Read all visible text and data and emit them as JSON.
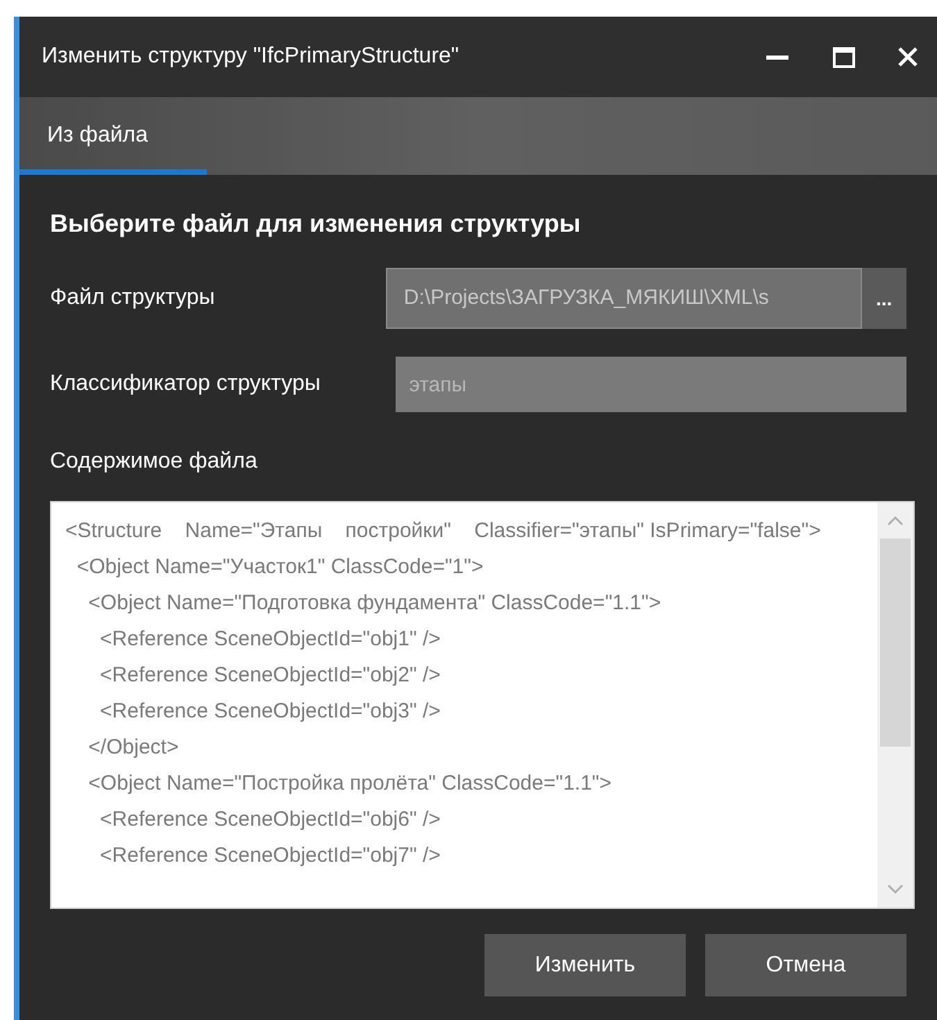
{
  "window": {
    "title": "Изменить структуру \"IfcPrimaryStructure\""
  },
  "tabs": [
    {
      "label": "Из файла",
      "selected": true
    }
  ],
  "heading": "Выберите файл для изменения структуры",
  "file_field": {
    "label": "Файл структуры",
    "value": "D:\\Projects\\ЗАГРУЗКА_МЯКИШ\\XML\\s",
    "browse": "..."
  },
  "classifier_field": {
    "label": "Классификатор структуры",
    "placeholder": "этапы"
  },
  "content": {
    "label": "Содержимое файла",
    "lines": [
      "<Structure    Name=\"Этапы    постройки\"    Classifier=\"этапы\" IsPrimary=\"false\">",
      "  <Object Name=\"Участок1\" ClassCode=\"1\">",
      "    <Object Name=\"Подготовка фундамента\" ClassCode=\"1.1\">",
      "      <Reference SceneObjectId=\"obj1\" />",
      "      <Reference SceneObjectId=\"obj2\" />",
      "      <Reference SceneObjectId=\"obj3\" />",
      "    </Object>",
      "    <Object Name=\"Постройка пролёта\" ClassCode=\"1.1\">",
      "      <Reference SceneObjectId=\"obj6\" />",
      "      <Reference SceneObjectId=\"obj7\" />"
    ]
  },
  "buttons": [
    "Изменить",
    "Отмена"
  ]
}
